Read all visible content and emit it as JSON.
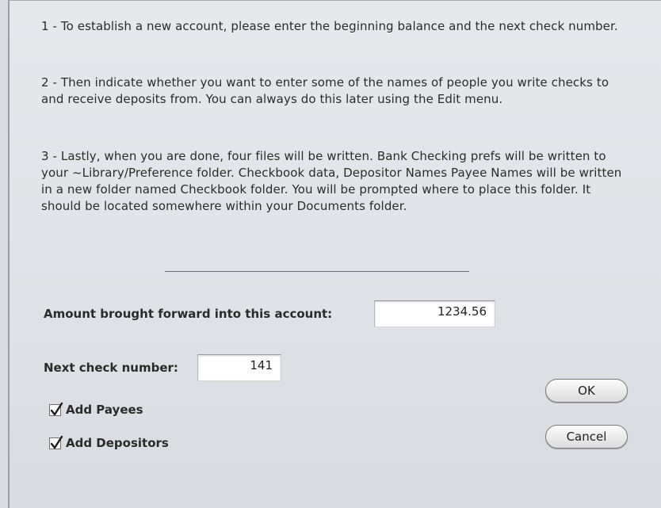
{
  "instructions": {
    "step1": "1 - To establish a new account, please enter the beginning balance and the next check number.",
    "step2": "2 - Then indicate whether you want to enter some of the names of people you write checks to and receive deposits from. You can always do this later using the Edit menu.",
    "step3": "3 - Lastly, when you are done, four files will be written. Bank Checking prefs will be written to your ~Library/Preference folder. Checkbook data, Depositor Names Payee Names will be written in a new folder named Checkbook folder. You will be prompted where to place this folder. It should be located somewhere within your Documents folder."
  },
  "form": {
    "amount_label": "Amount brought forward into this account:",
    "amount_value": "1234.56",
    "next_check_label": "Next check number:",
    "next_check_value": "141",
    "add_payees_label": "Add Payees",
    "add_payees_checked": true,
    "add_depositors_label": "Add Depositors",
    "add_depositors_checked": true
  },
  "buttons": {
    "ok": "OK",
    "cancel": "Cancel"
  }
}
